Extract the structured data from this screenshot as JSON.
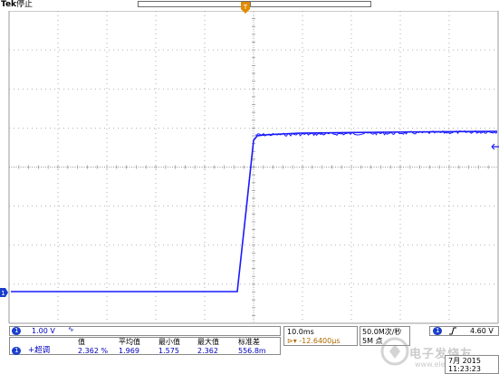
{
  "header": {
    "brand": "Tek",
    "status": "停止"
  },
  "channel": {
    "id": "1",
    "scale": "1.00 V",
    "bandwidth_icon": "bandwidth-limit-icon",
    "trace_color": "#1a1aff"
  },
  "measurement": {
    "badge": "1",
    "type": "+超调",
    "headers": {
      "value": "值",
      "mean": "平均值",
      "min": "最小值",
      "max": "最大值",
      "stdev": "标准差"
    },
    "values": {
      "value": "2.362 %",
      "mean": "1.969",
      "min": "1.575",
      "max": "2.362",
      "stdev": "556.8m"
    }
  },
  "horizontal": {
    "timebase": "10.0ms",
    "delay_icon": "delay-icon",
    "delay": "-12.6400µs",
    "sample_rate": "50.0M次/秒",
    "record_length": "5M 点"
  },
  "trigger": {
    "source": "1",
    "slope_icon": "rising-edge-icon",
    "level": "4.60 V"
  },
  "clock": {
    "date": "7月  2015",
    "time": "11:23:23"
  },
  "watermark": {
    "text": "电子发烧友",
    "sub": "www.elecfans.com"
  },
  "colors": {
    "trace": "#1a1aff",
    "grid": "#9a9a9a",
    "trigger_marker": "#e08a00",
    "badge": "#1b3fcc"
  }
}
